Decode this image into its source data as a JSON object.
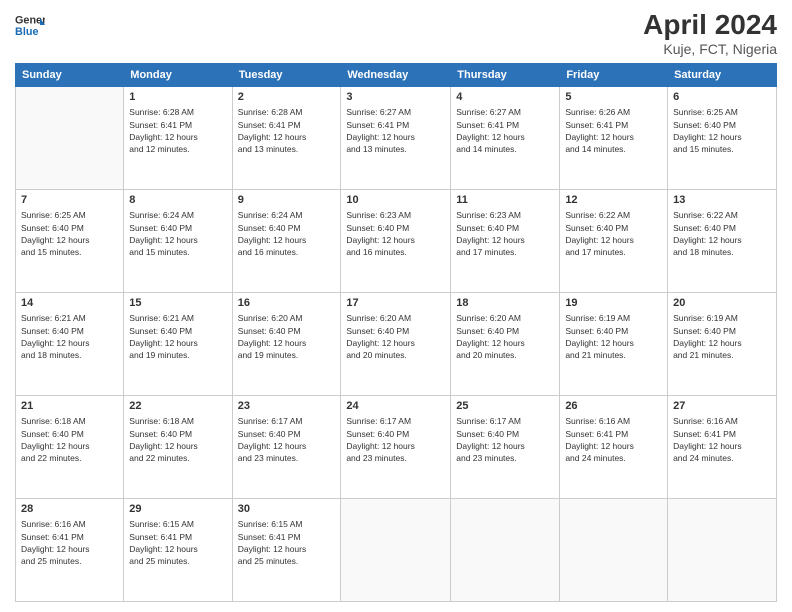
{
  "header": {
    "logo_line1": "General",
    "logo_line2": "Blue",
    "title": "April 2024",
    "subtitle": "Kuje, FCT, Nigeria"
  },
  "days_of_week": [
    "Sunday",
    "Monday",
    "Tuesday",
    "Wednesday",
    "Thursday",
    "Friday",
    "Saturday"
  ],
  "weeks": [
    [
      {
        "day": "",
        "info": ""
      },
      {
        "day": "1",
        "info": "Sunrise: 6:28 AM\nSunset: 6:41 PM\nDaylight: 12 hours\nand 12 minutes."
      },
      {
        "day": "2",
        "info": "Sunrise: 6:28 AM\nSunset: 6:41 PM\nDaylight: 12 hours\nand 13 minutes."
      },
      {
        "day": "3",
        "info": "Sunrise: 6:27 AM\nSunset: 6:41 PM\nDaylight: 12 hours\nand 13 minutes."
      },
      {
        "day": "4",
        "info": "Sunrise: 6:27 AM\nSunset: 6:41 PM\nDaylight: 12 hours\nand 14 minutes."
      },
      {
        "day": "5",
        "info": "Sunrise: 6:26 AM\nSunset: 6:41 PM\nDaylight: 12 hours\nand 14 minutes."
      },
      {
        "day": "6",
        "info": "Sunrise: 6:25 AM\nSunset: 6:40 PM\nDaylight: 12 hours\nand 15 minutes."
      }
    ],
    [
      {
        "day": "7",
        "info": "Sunrise: 6:25 AM\nSunset: 6:40 PM\nDaylight: 12 hours\nand 15 minutes."
      },
      {
        "day": "8",
        "info": "Sunrise: 6:24 AM\nSunset: 6:40 PM\nDaylight: 12 hours\nand 15 minutes."
      },
      {
        "day": "9",
        "info": "Sunrise: 6:24 AM\nSunset: 6:40 PM\nDaylight: 12 hours\nand 16 minutes."
      },
      {
        "day": "10",
        "info": "Sunrise: 6:23 AM\nSunset: 6:40 PM\nDaylight: 12 hours\nand 16 minutes."
      },
      {
        "day": "11",
        "info": "Sunrise: 6:23 AM\nSunset: 6:40 PM\nDaylight: 12 hours\nand 17 minutes."
      },
      {
        "day": "12",
        "info": "Sunrise: 6:22 AM\nSunset: 6:40 PM\nDaylight: 12 hours\nand 17 minutes."
      },
      {
        "day": "13",
        "info": "Sunrise: 6:22 AM\nSunset: 6:40 PM\nDaylight: 12 hours\nand 18 minutes."
      }
    ],
    [
      {
        "day": "14",
        "info": "Sunrise: 6:21 AM\nSunset: 6:40 PM\nDaylight: 12 hours\nand 18 minutes."
      },
      {
        "day": "15",
        "info": "Sunrise: 6:21 AM\nSunset: 6:40 PM\nDaylight: 12 hours\nand 19 minutes."
      },
      {
        "day": "16",
        "info": "Sunrise: 6:20 AM\nSunset: 6:40 PM\nDaylight: 12 hours\nand 19 minutes."
      },
      {
        "day": "17",
        "info": "Sunrise: 6:20 AM\nSunset: 6:40 PM\nDaylight: 12 hours\nand 20 minutes."
      },
      {
        "day": "18",
        "info": "Sunrise: 6:20 AM\nSunset: 6:40 PM\nDaylight: 12 hours\nand 20 minutes."
      },
      {
        "day": "19",
        "info": "Sunrise: 6:19 AM\nSunset: 6:40 PM\nDaylight: 12 hours\nand 21 minutes."
      },
      {
        "day": "20",
        "info": "Sunrise: 6:19 AM\nSunset: 6:40 PM\nDaylight: 12 hours\nand 21 minutes."
      }
    ],
    [
      {
        "day": "21",
        "info": "Sunrise: 6:18 AM\nSunset: 6:40 PM\nDaylight: 12 hours\nand 22 minutes."
      },
      {
        "day": "22",
        "info": "Sunrise: 6:18 AM\nSunset: 6:40 PM\nDaylight: 12 hours\nand 22 minutes."
      },
      {
        "day": "23",
        "info": "Sunrise: 6:17 AM\nSunset: 6:40 PM\nDaylight: 12 hours\nand 23 minutes."
      },
      {
        "day": "24",
        "info": "Sunrise: 6:17 AM\nSunset: 6:40 PM\nDaylight: 12 hours\nand 23 minutes."
      },
      {
        "day": "25",
        "info": "Sunrise: 6:17 AM\nSunset: 6:40 PM\nDaylight: 12 hours\nand 23 minutes."
      },
      {
        "day": "26",
        "info": "Sunrise: 6:16 AM\nSunset: 6:41 PM\nDaylight: 12 hours\nand 24 minutes."
      },
      {
        "day": "27",
        "info": "Sunrise: 6:16 AM\nSunset: 6:41 PM\nDaylight: 12 hours\nand 24 minutes."
      }
    ],
    [
      {
        "day": "28",
        "info": "Sunrise: 6:16 AM\nSunset: 6:41 PM\nDaylight: 12 hours\nand 25 minutes."
      },
      {
        "day": "29",
        "info": "Sunrise: 6:15 AM\nSunset: 6:41 PM\nDaylight: 12 hours\nand 25 minutes."
      },
      {
        "day": "30",
        "info": "Sunrise: 6:15 AM\nSunset: 6:41 PM\nDaylight: 12 hours\nand 25 minutes."
      },
      {
        "day": "",
        "info": ""
      },
      {
        "day": "",
        "info": ""
      },
      {
        "day": "",
        "info": ""
      },
      {
        "day": "",
        "info": ""
      }
    ]
  ]
}
